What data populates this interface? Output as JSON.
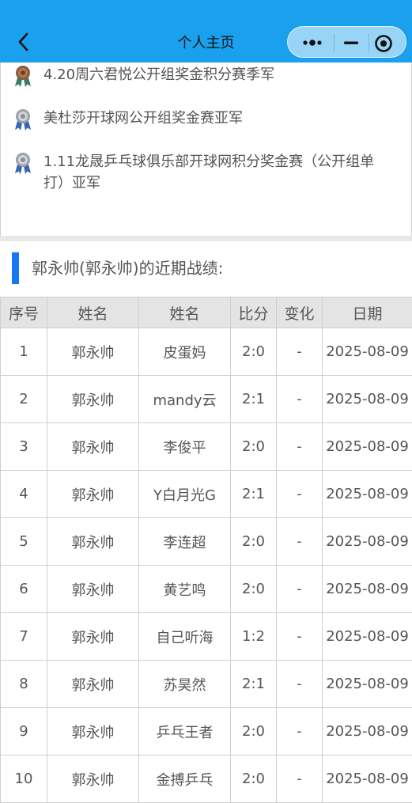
{
  "navbar": {
    "title": "个人主页",
    "back_icon": "chevron-left-icon",
    "more_icon": "more-dots-icon",
    "minimize_icon": "minimize-icon",
    "close_icon": "record-circle-icon",
    "bg_color": "#1aa0ec"
  },
  "awards": [
    {
      "medal": "bronze-medal-icon",
      "text": "4.20周六君悦公开组奖金积分赛季军"
    },
    {
      "medal": "silver-medal-icon",
      "text": "美杜莎开球网公开组奖金赛亚军"
    },
    {
      "medal": "silver-medal-icon",
      "text": "1.11龙晟乒乓球俱乐部开球网积分奖金赛（公开组单打）亚军"
    }
  ],
  "section": {
    "title": "郭永帅(郭永帅)的近期战绩:",
    "accent_color": "#1677f2"
  },
  "table": {
    "headers": [
      "序号",
      "姓名",
      "姓名",
      "比分",
      "变化",
      "日期"
    ],
    "rows": [
      [
        "1",
        "郭永帅",
        "皮蛋妈",
        "2:0",
        "-",
        "2025-08-09"
      ],
      [
        "2",
        "郭永帅",
        "mandy云",
        "2:1",
        "-",
        "2025-08-09"
      ],
      [
        "3",
        "郭永帅",
        "李俊平",
        "2:0",
        "-",
        "2025-08-09"
      ],
      [
        "4",
        "郭永帅",
        "Y白月光G",
        "2:1",
        "-",
        "2025-08-09"
      ],
      [
        "5",
        "郭永帅",
        "李连超",
        "2:0",
        "-",
        "2025-08-09"
      ],
      [
        "6",
        "郭永帅",
        "黄艺鸣",
        "2:0",
        "-",
        "2025-08-09"
      ],
      [
        "7",
        "郭永帅",
        "自己听海",
        "1:2",
        "-",
        "2025-08-09"
      ],
      [
        "8",
        "郭永帅",
        "苏昊然",
        "2:1",
        "-",
        "2025-08-09"
      ],
      [
        "9",
        "郭永帅",
        "乒乓王者",
        "2:0",
        "-",
        "2025-08-09"
      ],
      [
        "10",
        "郭永帅",
        "金搏乒乓",
        "2:0",
        "-",
        "2025-08-09"
      ]
    ]
  }
}
